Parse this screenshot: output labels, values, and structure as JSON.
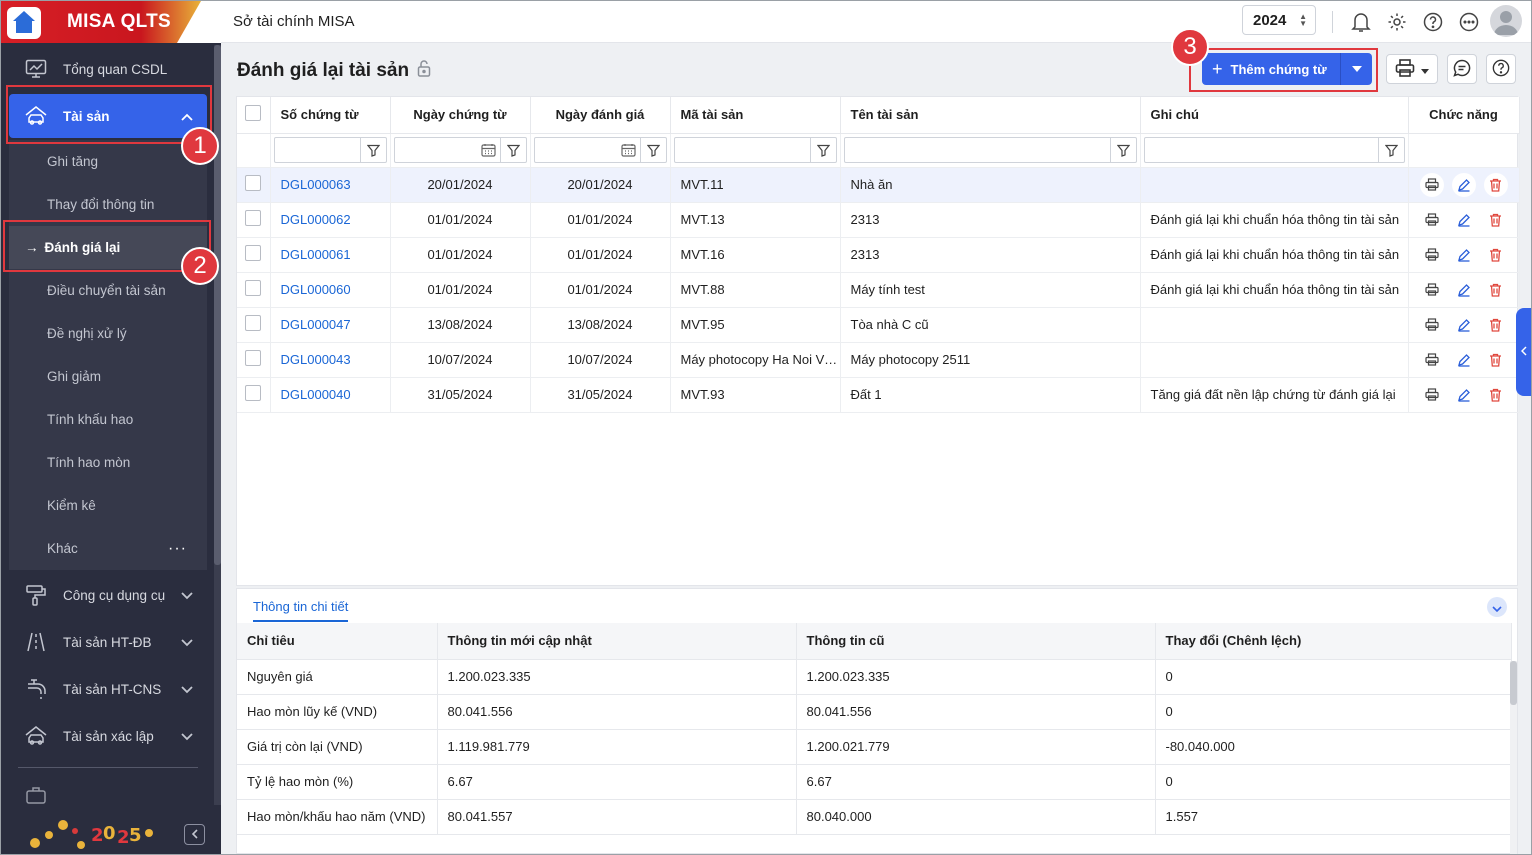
{
  "app": {
    "logo_text": "MISA QLTS",
    "org_name": "Sở tài chính MISA",
    "year": "2024"
  },
  "sidebar": {
    "items": [
      {
        "label": "Tổng quan CSDL",
        "icon": "monitor-icon"
      },
      {
        "label": "Tài sản",
        "icon": "car-house-icon"
      },
      {
        "label": "Công cụ dụng cụ",
        "icon": "paint-roller-icon"
      },
      {
        "label": "Tài sản HT-ĐB",
        "icon": "road-icon"
      },
      {
        "label": "Tài sản HT-CNS",
        "icon": "faucet-icon"
      },
      {
        "label": "Tài sản xác lập",
        "icon": "car-house-icon"
      }
    ],
    "sub_items": [
      {
        "label": "Ghi tăng"
      },
      {
        "label": "Thay đổi thông tin"
      },
      {
        "label": "Đánh giá lại",
        "arrow": "→"
      },
      {
        "label": "Điều chuyển tài sản"
      },
      {
        "label": "Đề nghị xử lý"
      },
      {
        "label": "Ghi giảm"
      },
      {
        "label": "Tính khấu hao"
      },
      {
        "label": "Tính hao mòn"
      },
      {
        "label": "Kiểm kê"
      },
      {
        "label": "Khác",
        "more": "···"
      }
    ],
    "collapse_icon": "chevron-left-icon"
  },
  "annotations": [
    "1",
    "2",
    "3"
  ],
  "page": {
    "title": "Đánh giá lại tài sản",
    "add_button": "Thêm chứng từ",
    "add_plus": "+"
  },
  "grid": {
    "columns": [
      "Số chứng từ",
      "Ngày chứng từ",
      "Ngày đánh giá",
      "Mã tài sản",
      "Tên tài sản",
      "Ghi chú",
      "Chức năng"
    ],
    "rows": [
      {
        "so": "DGL000063",
        "ngay_ct": "20/01/2024",
        "ngay_dg": "20/01/2024",
        "ma": "MVT.11",
        "ten": "Nhà ăn",
        "ghichu": ""
      },
      {
        "so": "DGL000062",
        "ngay_ct": "01/01/2024",
        "ngay_dg": "01/01/2024",
        "ma": "MVT.13",
        "ten": "2313",
        "ghichu": "Đánh giá lại khi chuẩn hóa thông tin tài sản"
      },
      {
        "so": "DGL000061",
        "ngay_ct": "01/01/2024",
        "ngay_dg": "01/01/2024",
        "ma": "MVT.16",
        "ten": "2313",
        "ghichu": "Đánh giá lại khi chuẩn hóa thông tin tài sản"
      },
      {
        "so": "DGL000060",
        "ngay_ct": "01/01/2024",
        "ngay_dg": "01/01/2024",
        "ma": "MVT.88",
        "ten": "Máy tính test",
        "ghichu": "Đánh giá lại khi chuẩn hóa thông tin tài sản"
      },
      {
        "so": "DGL000047",
        "ngay_ct": "13/08/2024",
        "ngay_dg": "13/08/2024",
        "ma": "MVT.95",
        "ten": "Tòa nhà C cũ",
        "ghichu": ""
      },
      {
        "so": "DGL000043",
        "ngay_ct": "10/07/2024",
        "ngay_dg": "10/07/2024",
        "ma": "Máy photocopy Ha Noi Việt Nam",
        "ten": "Máy photocopy 2511",
        "ghichu": ""
      },
      {
        "so": "DGL000040",
        "ngay_ct": "31/05/2024",
        "ngay_dg": "31/05/2024",
        "ma": "MVT.93",
        "ten": "Đất 1",
        "ghichu": "Tăng giá đất nền lập chứng từ đánh giá lại"
      }
    ]
  },
  "detail": {
    "tab": "Thông tin chi tiết",
    "columns": [
      "Chỉ tiêu",
      "Thông tin mới cập nhật",
      "Thông tin cũ",
      "Thay đổi (Chênh lệch)"
    ],
    "rows": [
      [
        "Nguyên giá",
        "1.200.023.335",
        "1.200.023.335",
        "0"
      ],
      [
        "Hao mòn lũy kế (VND)",
        "80.041.556",
        "80.041.556",
        "0"
      ],
      [
        "Giá trị còn lại (VND)",
        "1.119.981.779",
        "1.200.021.779",
        "-80.040.000"
      ],
      [
        "Tỷ lệ hao mòn (%)",
        "6.67",
        "6.67",
        "0"
      ],
      [
        "Hao mòn/khấu hao năm (VND)",
        "80.041.557",
        "80.040.000",
        "1.557"
      ]
    ]
  },
  "colors": {
    "primary": "#3563e9",
    "sidebar_bg": "#2a2d3e",
    "annotation": "#e0383e",
    "link": "#1a66d6",
    "delete": "#e0483e"
  }
}
